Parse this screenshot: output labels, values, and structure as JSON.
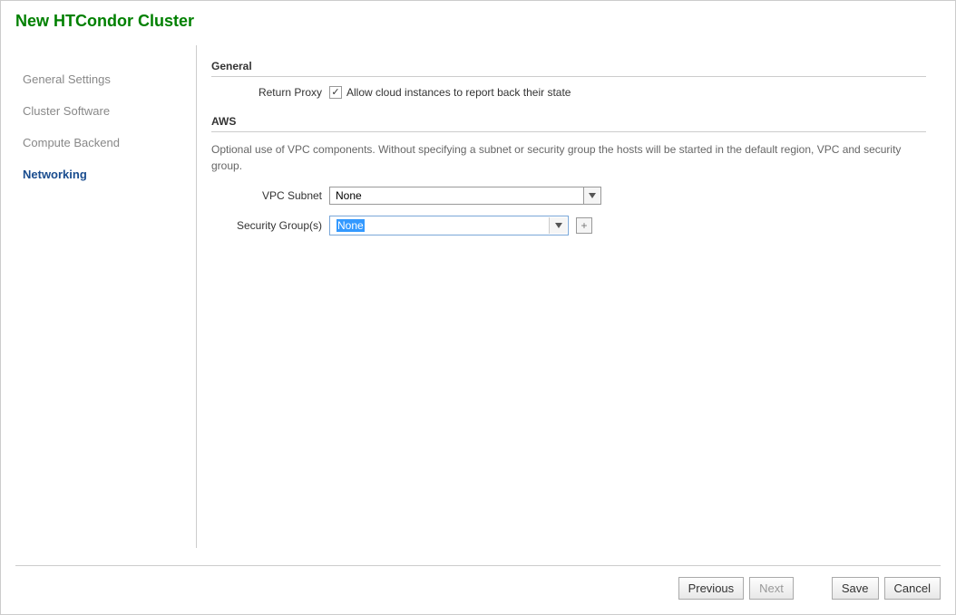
{
  "title": "New HTCondor Cluster",
  "sidebar": {
    "items": [
      {
        "label": "General Settings"
      },
      {
        "label": "Cluster Software"
      },
      {
        "label": "Compute Backend"
      },
      {
        "label": "Networking"
      }
    ],
    "activeIndex": 3
  },
  "sections": {
    "general": {
      "header": "General",
      "returnProxy": {
        "label": "Return Proxy",
        "checked": true,
        "description": "Allow cloud instances to report back their state"
      }
    },
    "aws": {
      "header": "AWS",
      "description": "Optional use of VPC components. Without specifying a subnet or security group the hosts will be started in the default region, VPC and security group.",
      "vpcSubnet": {
        "label": "VPC Subnet",
        "value": "None"
      },
      "securityGroup": {
        "label": "Security Group(s)",
        "value": "None",
        "addIcon": "+"
      }
    }
  },
  "footer": {
    "previous": "Previous",
    "next": "Next",
    "save": "Save",
    "cancel": "Cancel"
  },
  "checkmark": "✓"
}
